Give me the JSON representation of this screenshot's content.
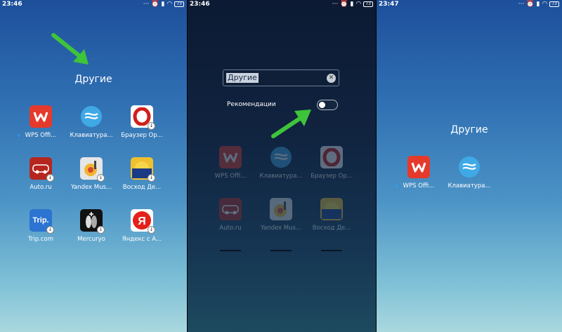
{
  "panels": [
    {
      "time": "23:46",
      "folder_title": "Другие",
      "apps": [
        {
          "label": "WPS Offi...",
          "icon": "wps-icon",
          "dot": true,
          "download": false
        },
        {
          "label": "Клавиатура...",
          "icon": "swiftkey-icon",
          "dot": false,
          "download": false
        },
        {
          "label": "Браузер Ор...",
          "icon": "opera-icon",
          "dot": false,
          "download": true
        },
        {
          "label": "Auto.ru",
          "icon": "autoru-icon",
          "dot": false,
          "download": true
        },
        {
          "label": "Yandex Mus...",
          "icon": "yandex-music-icon",
          "dot": false,
          "download": true
        },
        {
          "label": "Восход Де...",
          "icon": "voshod-icon",
          "dot": false,
          "download": true
        },
        {
          "label": "Trip.com",
          "icon": "trip-icon",
          "dot": false,
          "download": true
        },
        {
          "label": "Mercuryo",
          "icon": "mercuryo-icon",
          "dot": false,
          "download": true
        },
        {
          "label": "Яндекс с А...",
          "icon": "yandex-icon",
          "dot": false,
          "download": true
        }
      ]
    },
    {
      "time": "23:46",
      "name_input_value": "Другие",
      "recommendations_label": "Рекомендации",
      "recommendations_enabled": false,
      "apps": [
        {
          "label": "WPS Offi...",
          "icon": "wps-icon"
        },
        {
          "label": "Клавиатура...",
          "icon": "swiftkey-icon"
        },
        {
          "label": "Браузер Ор...",
          "icon": "opera-icon"
        },
        {
          "label": "Auto.ru",
          "icon": "autoru-icon"
        },
        {
          "label": "Yandex Mus...",
          "icon": "yandex-music-icon"
        },
        {
          "label": "Восход Де...",
          "icon": "voshod-icon"
        }
      ]
    },
    {
      "time": "23:47",
      "folder_title": "Другие",
      "apps": [
        {
          "label": "WPS Offi...",
          "icon": "wps-icon",
          "dot": true
        },
        {
          "label": "Клавиатура...",
          "icon": "swiftkey-icon",
          "dot": false
        }
      ]
    }
  ],
  "status_icons": [
    "dots",
    "alarm-icon",
    "signal-icon",
    "wifi-icon",
    "battery-icon"
  ],
  "battery_text": "73",
  "colors": {
    "arrow": "#3ec43a",
    "wps": "#e53a2b",
    "opera": "#d0201a"
  }
}
